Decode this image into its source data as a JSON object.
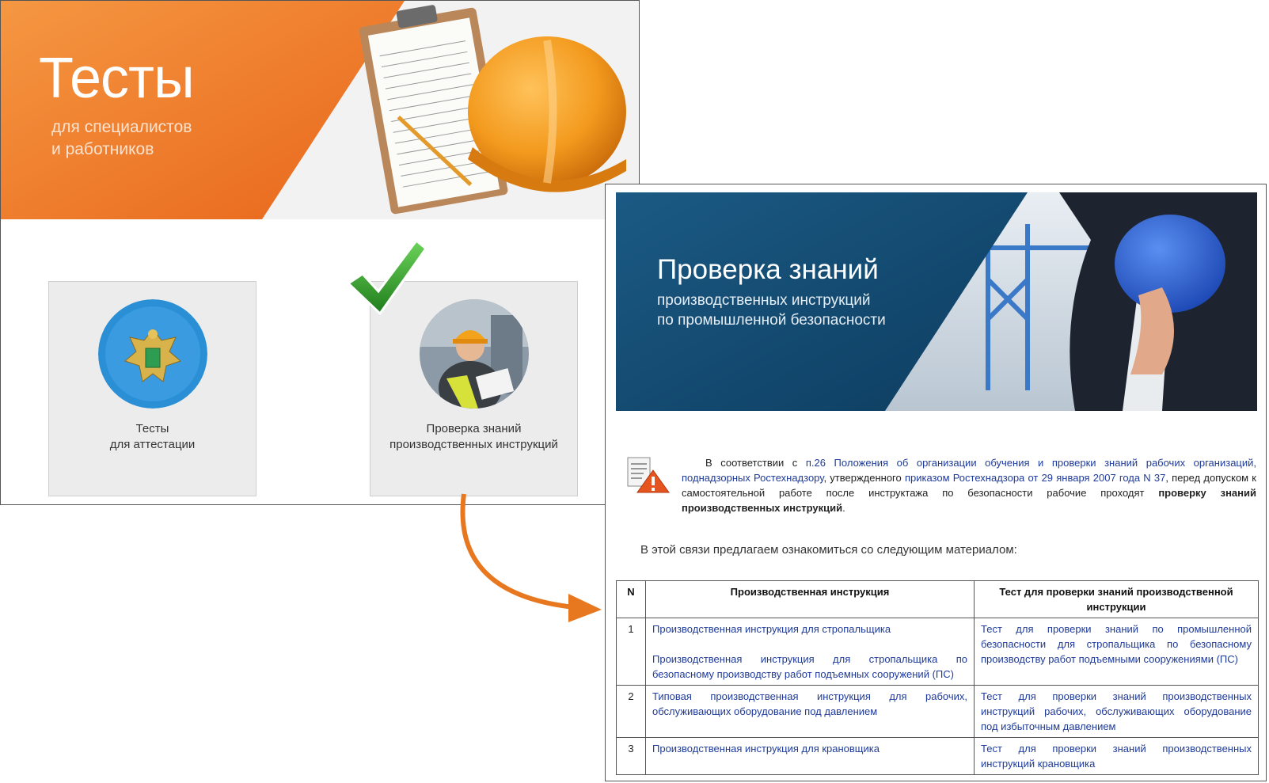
{
  "back": {
    "title": "Тесты",
    "subtitle_lines": [
      "для специалистов",
      "и работников"
    ],
    "tiles": [
      {
        "lines": [
          "Тесты",
          "для аттестации"
        ],
        "icon": "emblem-icon"
      },
      {
        "lines": [
          "Проверка знаний",
          "производственных инструкций"
        ],
        "icon": "worker-photo"
      }
    ]
  },
  "front": {
    "title": "Проверка знаний",
    "subtitle_lines": [
      "производственных инструкций",
      "по промышленной безопасности"
    ],
    "notice": {
      "prefix": "В соответствии с ",
      "link1": "п.26",
      "link2": "Положения об организации обучения и проверки знаний рабочих организаций, поднадзорных Ростехнадзору",
      "mid": ", утвержденного ",
      "link3": "приказом Ростехнадзора от 29 января 2007 года N 37",
      "suffix": ", перед допуском к самостоятельной работе после инструктажа по безопасности рабочие проходят ",
      "bold": "проверку знаний производственных инструкций",
      "end": "."
    },
    "intro": "В этой связи предлагаем ознакомиться со следующим материалом:",
    "table": {
      "headers": [
        "N",
        "Производственная инструкция",
        "Тест для проверки знаний производственной инструкции"
      ],
      "rows": [
        {
          "n": "1",
          "instructions": [
            "Производственная инструкция для стропальщика",
            "Производственная инструкция для стропальщика по безопасному производству работ подъемных сооружений (ПС)"
          ],
          "test": "Тест для проверки знаний по промышленной безопасности для стропальщика по безопасному производству работ подъемными сооружениями (ПС)"
        },
        {
          "n": "2",
          "instructions": [
            "Типовая производственная инструкция для рабочих, обслуживающих оборудование под давлением"
          ],
          "test": "Тест для проверки знаний производственных инструкций рабочих, обслуживающих оборудование под избыточным давлением"
        },
        {
          "n": "3",
          "instructions": [
            "Производственная инструкция для крановщика"
          ],
          "test": "Тест для проверки знаний производственных инструкций крановщика"
        }
      ]
    }
  },
  "colors": {
    "orange": "#f07f2b",
    "navy": "#12486e",
    "link": "#1f3b9a",
    "check_green": "#2f9a2a"
  }
}
